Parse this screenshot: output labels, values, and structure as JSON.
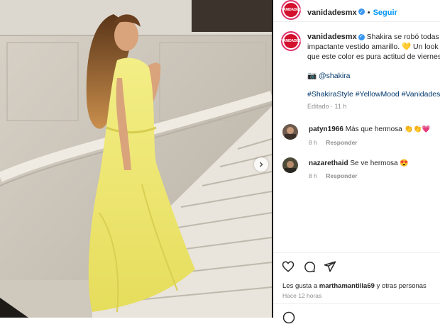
{
  "colors": {
    "accent": "#0095f6",
    "link": "#00376b",
    "brand_red": "#d3102e",
    "muted": "#8e8e8e"
  },
  "post": {
    "avatar_text": "VANIDADES",
    "username": "vanidadesmx",
    "follow_label": "Seguir",
    "dot": "•",
    "caption": {
      "username": "vanidadesmx",
      "line1": "Shakira se robó todas las",
      "line2": "impactante vestido amarillo. 💛 Un look",
      "line3": "que este color es pura actitud de viernes.",
      "mention_icon": "📷",
      "mention": "@shakira",
      "hashtags": "#ShakiraStyle #YellowMood #VanidadesF",
      "edited": "Editado · 11 h"
    },
    "comments": [
      {
        "username": "patyn1966",
        "text": "Más que hermosa 👏👏💗",
        "age": "8 h",
        "reply": "Responder"
      },
      {
        "username": "nazarethaid",
        "text": "Se ve hermosa 😍",
        "age": "8 h",
        "reply": "Responder"
      }
    ],
    "likes": {
      "prefix": "Les gusta a",
      "user": "marthamantilla69",
      "suffix": "y otras personas"
    },
    "posted": "Hace 12 horas"
  }
}
